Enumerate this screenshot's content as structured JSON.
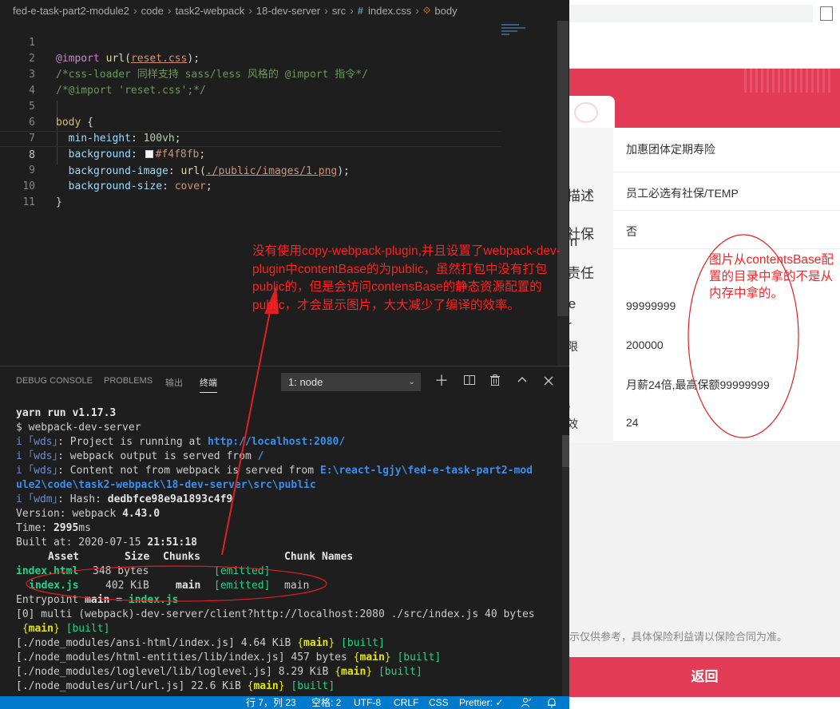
{
  "breadcrumb": [
    "fed-e-task-part2-module2",
    "code",
    "task2-webpack",
    "18-dev-server",
    "src",
    "index.css",
    "body"
  ],
  "editor": {
    "lines": [
      "1",
      "2",
      "3",
      "4",
      "5",
      "6",
      "7",
      "8",
      "9",
      "10",
      "11"
    ],
    "l1": {
      "kw": "@import",
      "fn": "url(",
      "val": "reset.css",
      "end": ");"
    },
    "l2": "/*css-loader 同样支持 sass/less 风格的 @import 指令*/",
    "l3": "/*@import 'reset.css';*/",
    "l5": {
      "sel": "body",
      "brace": " {"
    },
    "l6": {
      "prop": "min-height",
      "val": "100vh",
      "end": ";"
    },
    "l7": {
      "prop": "background",
      "val": "#f4f8fb",
      "end": ";"
    },
    "l8": {
      "prop": "background-image",
      "fn": "url(",
      "val": "./public/images/1.png",
      "end": ");"
    },
    "l9": {
      "prop": "background-size",
      "val": "cover",
      "end": ";"
    },
    "l10": "}",
    "swatch_color": "#f4f8fb"
  },
  "panel": {
    "tabs": [
      "DEBUG CONSOLE",
      "PROBLEMS",
      "输出",
      "终端"
    ],
    "active_tab": "终端",
    "terminal_select": "1: node",
    "icons": [
      "plus-icon",
      "split-icon",
      "trash-icon",
      "chevron-up-icon",
      "close-icon"
    ]
  },
  "terminal": {
    "l1": "yarn run v1.17.3",
    "l2": "$ webpack-dev-server",
    "l3": {
      "pre": "i ｢wds｣",
      "text": ": Project is running at ",
      "url": "http://localhost:2080/"
    },
    "l4": {
      "pre": "i ｢wds｣",
      "text": ": webpack output is served from ",
      "path": "/"
    },
    "l5": {
      "pre": "i ｢wds｣",
      "text": ": Content not from webpack is served from ",
      "path": "E:\\react-lgjy\\fed-e-task-part2-mod"
    },
    "l5b": "ule2\\code\\task2-webpack\\18-dev-server\\src\\public",
    "l6": {
      "pre": "i ｢wdm｣",
      "text": ": Hash: ",
      "hash": "dedbfce98e9a1893c4f9"
    },
    "l7": {
      "label": "Version: webpack ",
      "value": "4.43.0"
    },
    "l8": {
      "label": "Time: ",
      "value": "2995",
      "unit": "ms"
    },
    "l9": {
      "label": "Built at: 2020-07-15 ",
      "value": "21:51:18"
    },
    "header": {
      "asset": "Asset",
      "size": "Size",
      "chunks": "Chunks",
      "names": "Chunk Names"
    },
    "assets": [
      {
        "name": "index.html",
        "size": "348 bytes",
        "chunks": "",
        "emitted": "[emitted]",
        "names": ""
      },
      {
        "name": "index.js",
        "size": "402 KiB",
        "chunks": "main",
        "emitted": "[emitted]",
        "names": "main"
      }
    ],
    "entry": {
      "label": "Entrypoint ",
      "name": "main",
      "eq": " = ",
      "file": "index.js"
    },
    "l_multi": "[0] multi (webpack)-dev-server/client?http://localhost:2080 ./src/index.js 40 bytes",
    "l_multi_main": "main",
    "l_multi_built": "[built]",
    "modules": [
      {
        "path": "[./node_modules/ansi-html/index.js]",
        "size": " 4.64 KiB ",
        "chunk": "main",
        "built": "[built]"
      },
      {
        "path": "[./node_modules/html-entities/lib/index.js]",
        "size": " 457 bytes ",
        "chunk": "main",
        "built": "[built]"
      },
      {
        "path": "[./node_modules/loglevel/lib/loglevel.js]",
        "size": " 8.29 KiB ",
        "chunk": "main",
        "built": "[built]"
      },
      {
        "path": "[./node_modules/url/url.js]",
        "size": " 22.6 KiB ",
        "chunk": "main",
        "built": "[built]"
      }
    ]
  },
  "statusbar": {
    "position": "行 7，列 23",
    "spaces": "空格: 2",
    "encoding": "UTF-8",
    "eol": "CRLF",
    "language": "CSS",
    "formatter": "Prettier: ✓",
    "icons": [
      "person-icon",
      "bell-icon"
    ]
  },
  "browser": {
    "labels": [
      "描述",
      "社保",
      "in",
      "责任",
      "ie",
      "r",
      "限",
      "e",
      "效"
    ],
    "values": [
      "加惠团体定期寿险",
      "员工必选有社保/TEMP",
      "否",
      "99999999",
      "200000",
      "月薪24倍,最高保额99999999",
      "24"
    ],
    "disclaimer": "示仅供参考，具体保险利益请以保险合同为准。",
    "back_button": "返回",
    "accent_color": "#e23b55"
  },
  "annotations": {
    "note1": "没有使用copy-webpack-plugin,并且设置了webpack-dev-plugin中contentBase的为public，虽然打包中没有打包public的，但是会访问contensBase的静态资源配置的public，才会显示图片，大大减少了编译的效率。",
    "note2": "图片从contentsBase配置的目录中拿的不是从内存中拿的。",
    "color": "#ff2020"
  }
}
